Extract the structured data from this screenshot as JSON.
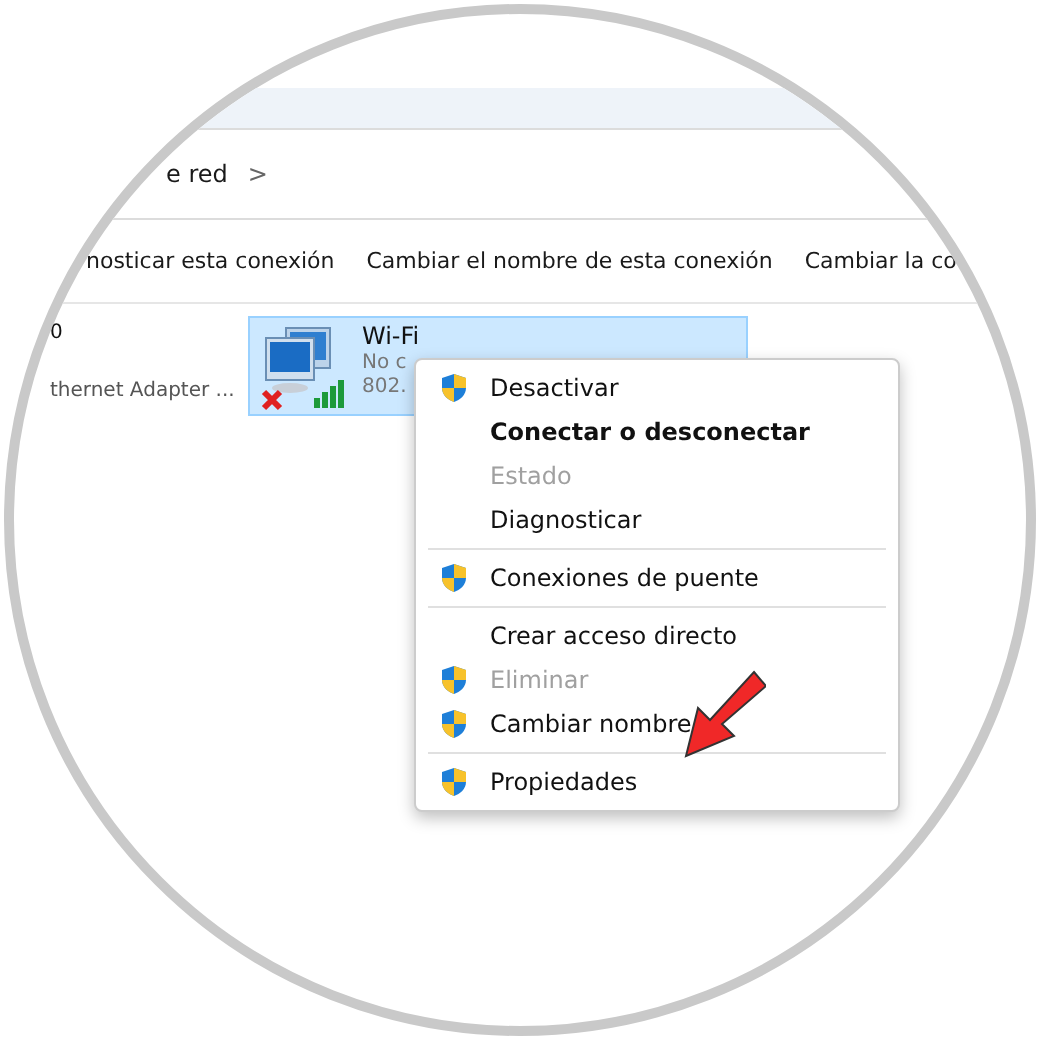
{
  "address_bar": {
    "crumb": "e red",
    "separator": ">"
  },
  "toolbar": [
    "nosticar esta conexión",
    "Cambiar el nombre de esta conexión",
    "Cambiar la co"
  ],
  "ethernet_tile": {
    "name": "0",
    "description": "thernet Adapter ..."
  },
  "wifi_tile": {
    "name": "Wi-Fi",
    "status": "No c",
    "description": "802.",
    "selected": true
  },
  "context_menu": [
    {
      "kind": "item",
      "label": "Desactivar",
      "shield": true,
      "bold": false,
      "disabled": false
    },
    {
      "kind": "item",
      "label": "Conectar o desconectar",
      "shield": false,
      "bold": true,
      "disabled": false
    },
    {
      "kind": "item",
      "label": "Estado",
      "shield": false,
      "bold": false,
      "disabled": true
    },
    {
      "kind": "item",
      "label": "Diagnosticar",
      "shield": false,
      "bold": false,
      "disabled": false
    },
    {
      "kind": "separator"
    },
    {
      "kind": "item",
      "label": "Conexiones de puente",
      "shield": true,
      "bold": false,
      "disabled": false
    },
    {
      "kind": "separator"
    },
    {
      "kind": "item",
      "label": "Crear acceso directo",
      "shield": false,
      "bold": false,
      "disabled": false
    },
    {
      "kind": "item",
      "label": "Eliminar",
      "shield": true,
      "bold": false,
      "disabled": true
    },
    {
      "kind": "item",
      "label": "Cambiar nombre",
      "shield": true,
      "bold": false,
      "disabled": false
    },
    {
      "kind": "separator"
    },
    {
      "kind": "item",
      "label": "Propiedades",
      "shield": true,
      "bold": false,
      "disabled": false
    }
  ]
}
